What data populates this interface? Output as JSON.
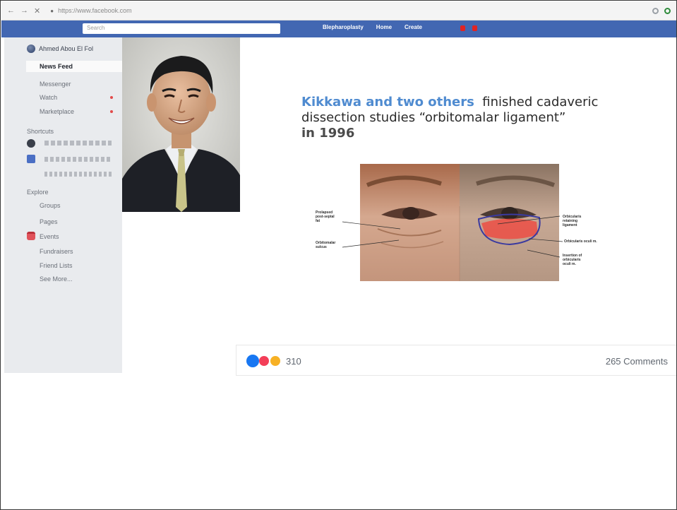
{
  "browser": {
    "url": "https://www.facebook.com"
  },
  "fb_header": {
    "search_placeholder": "Search",
    "page_name": "Blepharoplasty",
    "nav_home": "Home",
    "nav_create": "Create"
  },
  "sidebar": {
    "user_name": "Ahmed Abou El Fol",
    "items": [
      {
        "label": "News Feed",
        "active": true
      },
      {
        "label": "Messenger"
      },
      {
        "label": "Watch"
      },
      {
        "label": "Marketplace"
      }
    ],
    "shortcuts_header": "Shortcuts",
    "explore_header": "Explore",
    "explore_items": [
      "Groups",
      "Pages",
      "Events",
      "Fundraisers",
      "Friend Lists",
      "See More..."
    ]
  },
  "slide": {
    "highlight_text": "Kikkawa and two others",
    "text_rest": "finished cadaveric",
    "text_line2": "dissection studies “orbitomalar ligament”",
    "text_year": "in 1996"
  },
  "figure_labels": {
    "left_1": "Prolapsed\npost-septal\nfat",
    "left_2": "Orbitomalar\nsulcus",
    "right_1": "Orbicularis\nretaining\nligament",
    "right_2": "Orbicularis oculi m.",
    "right_3": "Insertion of\norbicularis\noculi m."
  },
  "reactions": {
    "count": "310",
    "comments": "265 Comments"
  },
  "colors": {
    "fb_blue": "#4267b2",
    "highlight_blue": "#4f8bd0"
  }
}
